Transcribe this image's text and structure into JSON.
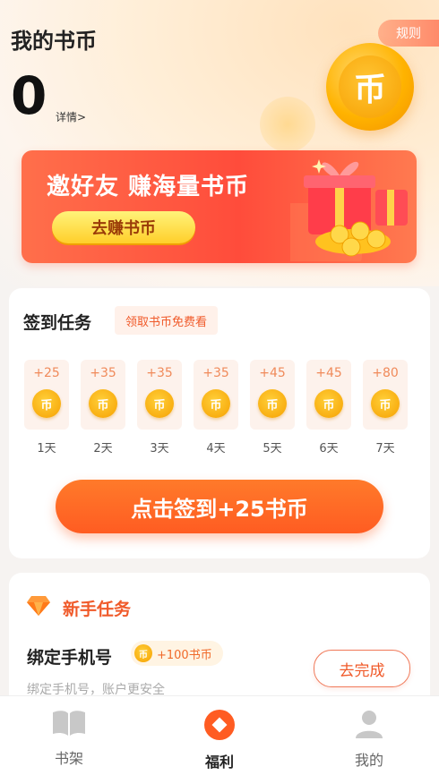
{
  "header": {
    "title": "我的书币",
    "rules_label": "规则",
    "balance": "0",
    "details_label": "详情>",
    "coin_char": "币"
  },
  "banner": {
    "title": "邀好友 赚海量书币",
    "button_label": "去赚书币"
  },
  "checkin": {
    "title": "签到任务",
    "chip": "领取书币免费看",
    "coin_char": "币",
    "days": [
      {
        "amount": "+25",
        "label": "1天"
      },
      {
        "amount": "+35",
        "label": "2天"
      },
      {
        "amount": "+35",
        "label": "3天"
      },
      {
        "amount": "+35",
        "label": "4天"
      },
      {
        "amount": "+45",
        "label": "5天"
      },
      {
        "amount": "+45",
        "label": "6天"
      },
      {
        "amount": "+80",
        "label": "7天"
      }
    ],
    "button_label": "点击签到+25书币"
  },
  "newbie": {
    "title": "新手任务",
    "task": {
      "name": "绑定手机号",
      "reward": "+100书币",
      "description": "绑定手机号，账户更安全",
      "button_label": "去完成"
    }
  },
  "tabbar": {
    "items": [
      {
        "label": "书架",
        "icon": "book-icon"
      },
      {
        "label": "福利",
        "icon": "welfare-icon",
        "active": true
      },
      {
        "label": "我的",
        "icon": "user-icon"
      }
    ]
  },
  "colors": {
    "accent": "#ff5c22",
    "coin": "#f6a000"
  }
}
